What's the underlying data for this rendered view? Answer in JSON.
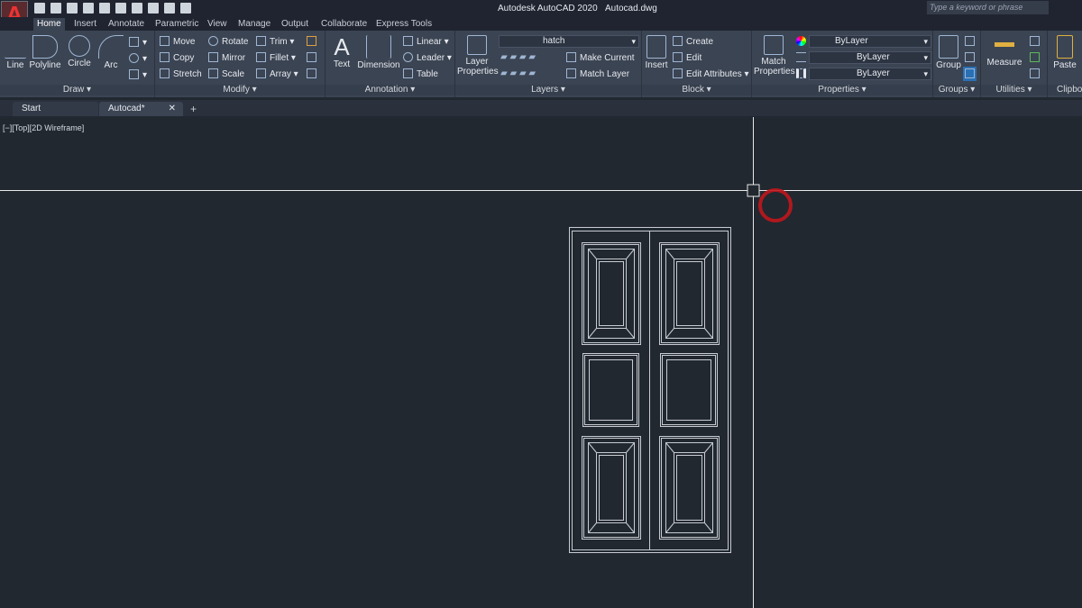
{
  "app": {
    "title": "Autodesk AutoCAD 2020",
    "file": "Autocad.dwg",
    "logo_letter": "A",
    "search_placeholder": "Type a keyword or phrase"
  },
  "ribbon_tabs": [
    "Home",
    "Insert",
    "Annotate",
    "Parametric",
    "View",
    "Manage",
    "Output",
    "Collaborate",
    "Express Tools"
  ],
  "draw": {
    "title": "Draw",
    "line": "Line",
    "polyline": "Polyline",
    "circle": "Circle",
    "arc": "Arc"
  },
  "modify": {
    "title": "Modify",
    "items": [
      "Move",
      "Rotate",
      "Trim",
      "Copy",
      "Mirror",
      "Fillet",
      "Stretch",
      "Scale",
      "Array"
    ]
  },
  "annotation": {
    "title": "Annotation",
    "text": "Text",
    "dimension": "Dimension",
    "linear": "Linear",
    "leader": "Leader",
    "table": "Table"
  },
  "layers": {
    "title": "Layers",
    "layer_properties": "Layer Properties",
    "current_layer": "hatch",
    "make_current": "Make Current",
    "match_layer": "Match Layer"
  },
  "block": {
    "title": "Block",
    "insert": "Insert",
    "create": "Create",
    "edit": "Edit",
    "edit_attributes": "Edit Attributes"
  },
  "properties": {
    "title": "Properties",
    "match_properties": "Match Properties",
    "color": "ByLayer",
    "lineweight": "ByLayer",
    "linetype": "ByLayer"
  },
  "groups": {
    "title": "Groups",
    "group": "Group"
  },
  "utilities": {
    "title": "Utilities",
    "measure": "Measure"
  },
  "clipboard": {
    "title": "Clipboard",
    "paste": "Paste"
  },
  "doc_tabs": {
    "start": "Start",
    "current": "Autocad*",
    "close": "✕",
    "add": "+"
  },
  "viewport": {
    "label": "[−][Top][2D Wireframe]"
  },
  "colors": {
    "canvas": "#212830",
    "ribbon": "#3b4453",
    "cursor_ring": "#c0161c"
  }
}
